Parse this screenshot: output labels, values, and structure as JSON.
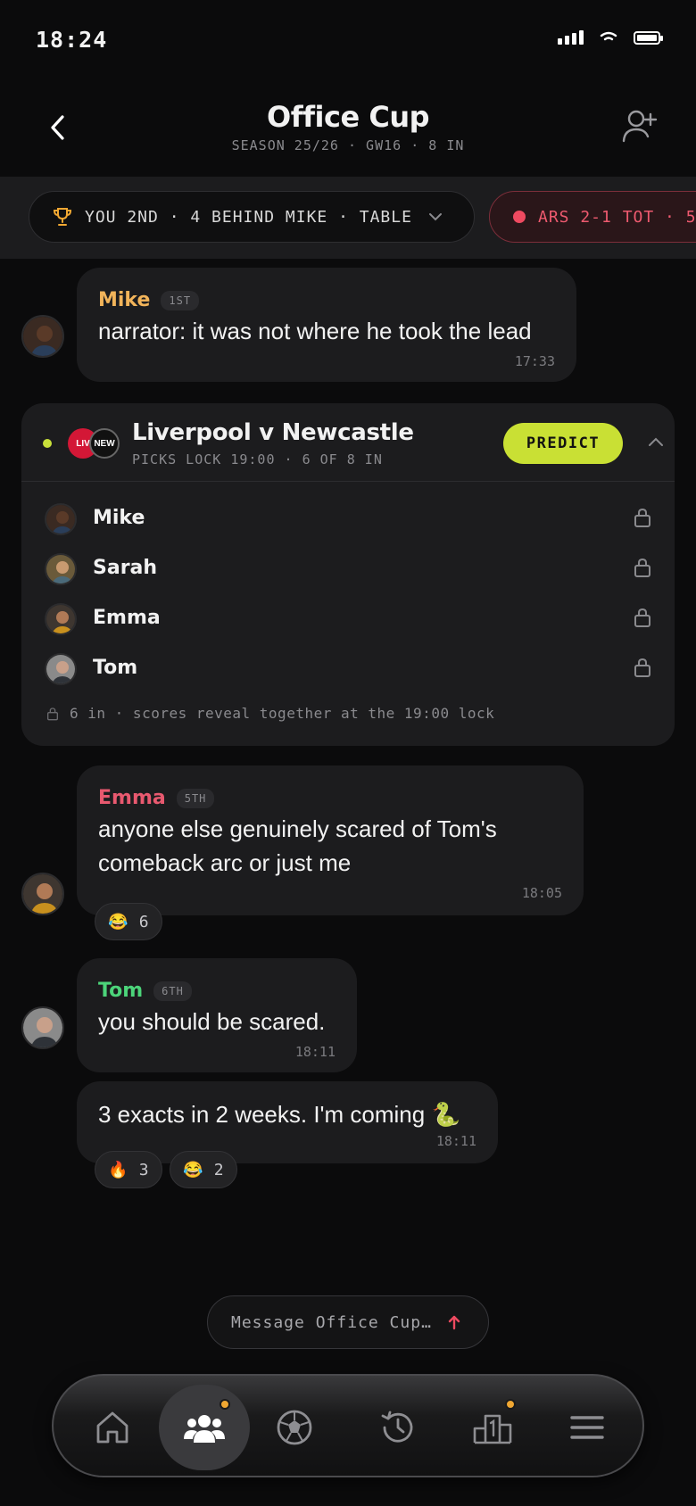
{
  "status": {
    "time": "18:24"
  },
  "header": {
    "title": "Office Cup",
    "subtitle": "SEASON 25/26 · GW16 · 8 IN"
  },
  "pills": {
    "standing": "YOU 2ND · 4 BEHIND MIKE · TABLE",
    "live": "ARS 2-1 TOT · 5"
  },
  "messages": [
    {
      "name": "Mike",
      "rank": "1ST",
      "text": "narrator: it was not where he took the lead",
      "time": "17:33",
      "name_color": "#f2b45a"
    },
    {
      "name": "Emma",
      "rank": "5TH",
      "text_line1": "anyone else genuinely scared of Tom's",
      "text_line2": "comeback arc or just me",
      "time": "18:05",
      "name_color": "#e8596f",
      "reactions": [
        {
          "emoji": "😂",
          "count": "6"
        }
      ]
    },
    {
      "name": "Tom",
      "rank": "6TH",
      "text": "you should be scared.",
      "time": "18:11",
      "name_color": "#4cd47a"
    },
    {
      "text": "3 exacts in 2 weeks. I'm coming 🐍",
      "time": "18:11",
      "reactions": [
        {
          "emoji": "🔥",
          "count": "3"
        },
        {
          "emoji": "😂",
          "count": "2"
        }
      ]
    }
  ],
  "match": {
    "home_crest": "LIV",
    "away_crest": "NEW",
    "title": "Liverpool v Newcastle",
    "subtitle": "PICKS LOCK 19:00 · 6 OF 8 IN",
    "predict_label": "PREDICT",
    "picks": [
      "Mike",
      "Sarah",
      "Emma",
      "Tom"
    ],
    "footer": "6 in · scores reveal together at the 19:00 lock",
    "accent": "#c9e034"
  },
  "composer": {
    "placeholder": "Message Office Cup…"
  },
  "tabs": [
    "home",
    "groups",
    "matches",
    "history",
    "leaderboard",
    "menu"
  ],
  "colors": {
    "background": "#0b0b0c",
    "bubble": "#1c1c1e",
    "live": "#ee4a60",
    "notification": "#f0a732"
  }
}
